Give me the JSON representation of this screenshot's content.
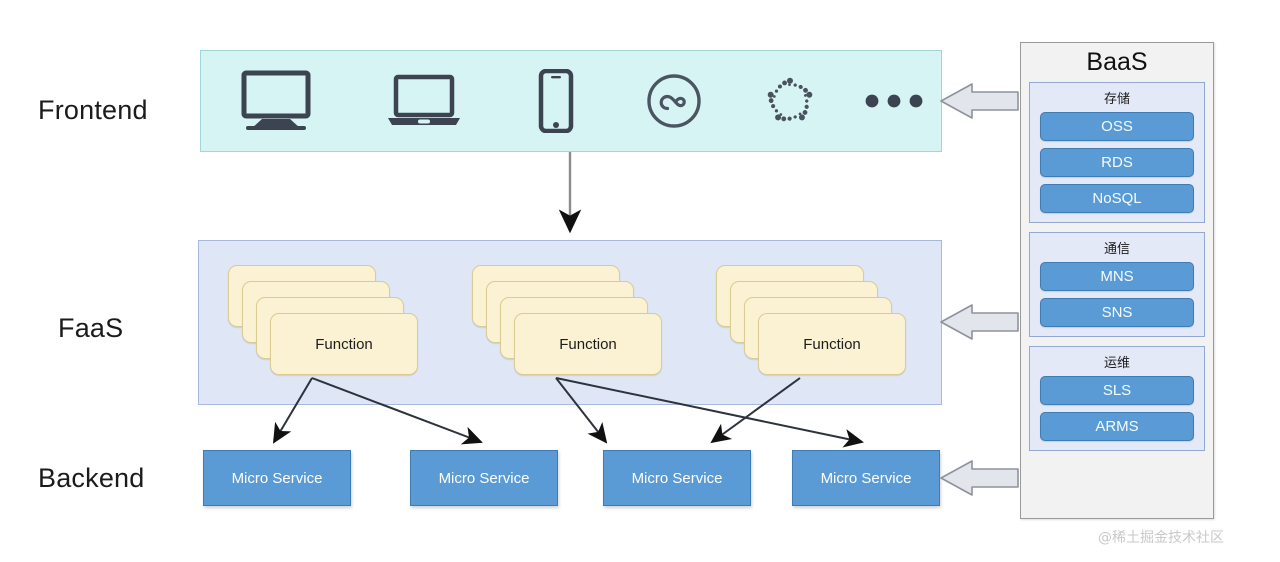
{
  "layers": [
    {
      "id": "frontend",
      "label": "Frontend"
    },
    {
      "id": "faas",
      "label": "FaaS"
    },
    {
      "id": "backend",
      "label": "Backend"
    }
  ],
  "frontend": {
    "devices": [
      {
        "icon": "desktop-monitor-icon",
        "name": "desktop"
      },
      {
        "icon": "laptop-icon",
        "name": "laptop"
      },
      {
        "icon": "smartphone-icon",
        "name": "smartphone"
      },
      {
        "icon": "wechat-miniprogram-icon",
        "name": "wechat-mini-program"
      },
      {
        "icon": "alipay-miniprogram-icon",
        "name": "alipay-mini-program"
      },
      {
        "icon": "ellipsis-icon",
        "name": "more"
      }
    ]
  },
  "faas": {
    "functions": [
      {
        "label": "Function",
        "stack_count": 4
      },
      {
        "label": "Function",
        "stack_count": 4
      },
      {
        "label": "Function",
        "stack_count": 4
      }
    ]
  },
  "backend": {
    "services": [
      {
        "label": "Micro Service"
      },
      {
        "label": "Micro Service"
      },
      {
        "label": "Micro Service"
      },
      {
        "label": "Micro Service"
      }
    ]
  },
  "baas": {
    "title": "BaaS",
    "groups": [
      {
        "title": "存储",
        "items": [
          {
            "label": "OSS"
          },
          {
            "label": "RDS"
          },
          {
            "label": "NoSQL"
          }
        ]
      },
      {
        "title": "通信",
        "items": [
          {
            "label": "MNS"
          },
          {
            "label": "SNS"
          }
        ]
      },
      {
        "title": "运维",
        "items": [
          {
            "label": "SLS"
          },
          {
            "label": "ARMS"
          }
        ]
      }
    ]
  },
  "watermark": {
    "text": "@稀土掘金技术社区"
  },
  "colors": {
    "frontend_bar": "#d6f4f3",
    "faas_bar": "#dfe6f6",
    "function_card": "#fbf2d3",
    "service_blue": "#5a9bd5",
    "baas_panel": "#f2f2f2",
    "baas_group": "#e3e9f7"
  }
}
